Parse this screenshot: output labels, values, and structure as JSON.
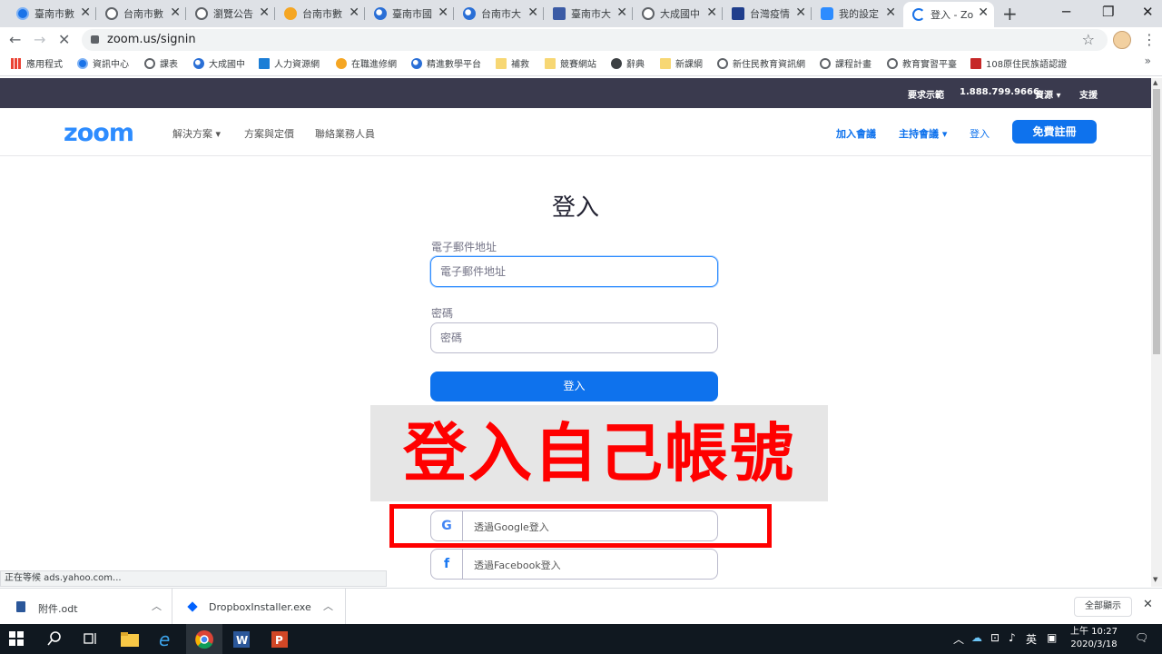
{
  "browser": {
    "tabs": [
      {
        "title": "臺南市數",
        "icon": "globe-icon"
      },
      {
        "title": "台南市數",
        "icon": "grey-globe-icon"
      },
      {
        "title": "瀏覽公告",
        "icon": "grey-globe-icon"
      },
      {
        "title": "台南市數",
        "icon": "orange-app-icon"
      },
      {
        "title": "臺南市國",
        "icon": "ie-icon"
      },
      {
        "title": "台南市大",
        "icon": "ie-icon"
      },
      {
        "title": "臺南市大",
        "icon": "square-app-icon"
      },
      {
        "title": "大成國中",
        "icon": "grey-globe-icon"
      },
      {
        "title": "台灣疫情",
        "icon": "chart-app-icon"
      },
      {
        "title": "我的設定",
        "icon": "zoom-icon"
      },
      {
        "title": "登入 - Zo",
        "icon": "loading-icon",
        "active": true
      }
    ],
    "url": "zoom.us/signin",
    "bookmarks": [
      {
        "label": "應用程式",
        "icon": "apps-grid-icon"
      },
      {
        "label": "資訊中心",
        "icon": "globe-icon"
      },
      {
        "label": "課表",
        "icon": "grey-globe-icon"
      },
      {
        "label": "大成國中",
        "icon": "ie-icon"
      },
      {
        "label": "人力資源網",
        "icon": "people-icon"
      },
      {
        "label": "在職進修網",
        "icon": "orange-app-icon"
      },
      {
        "label": "精進數學平台",
        "icon": "ie-icon"
      },
      {
        "label": "補救",
        "icon": "folder-icon"
      },
      {
        "label": "競賽網站",
        "icon": "folder-icon"
      },
      {
        "label": "辭典",
        "icon": "emblem-icon"
      },
      {
        "label": "新課綱",
        "icon": "folder-icon"
      },
      {
        "label": "新住民教育資訊網",
        "icon": "grey-globe-icon"
      },
      {
        "label": "課程計畫",
        "icon": "grey-globe-icon"
      },
      {
        "label": "教育實習平臺",
        "icon": "grey-globe-icon"
      },
      {
        "label": "108原住民族語認證",
        "icon": "red-emblem-icon"
      }
    ],
    "status_text": "正在等候 ads.yahoo.com..."
  },
  "site": {
    "topbar": {
      "demo": "要求示範",
      "phone": "1.888.799.9666",
      "resources": "資源 ▾",
      "support": "支援"
    },
    "nav": {
      "logo": "zoom",
      "solutions": "解決方案 ▾",
      "plans": "方案與定價",
      "contact_sales": "聯絡業務人員",
      "join": "加入會議",
      "host": "主持會議 ▾",
      "signin": "登入",
      "signup": "免費註冊"
    },
    "form": {
      "title": "登入",
      "email_label": "電子郵件地址",
      "email_placeholder": "電子郵件地址",
      "password_label": "密碼",
      "password_placeholder": "密碼",
      "signin_button": "登入",
      "google_label": "透過Google登入",
      "google_icon": "G",
      "facebook_label": "透過Facebook登入",
      "facebook_icon": "f"
    },
    "overlay": {
      "text": "登入自己帳號",
      "color": "#ff0000"
    }
  },
  "downloads": {
    "items": [
      {
        "name": "附件.odt",
        "icon": "document-icon"
      },
      {
        "name": "DropboxInstaller.exe",
        "icon": "dropbox-icon"
      }
    ],
    "show_all": "全部顯示"
  },
  "taskbar": {
    "ime": "英",
    "time": "上午 10:27",
    "date": "2020/3/18"
  },
  "colors": {
    "zoom_blue": "#0e72ed",
    "topbar_bg": "#3a3a4e"
  }
}
